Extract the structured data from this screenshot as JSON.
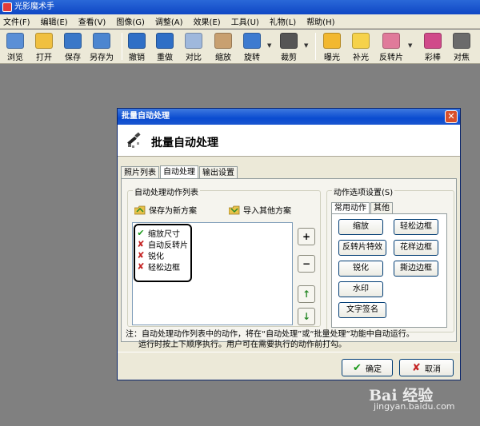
{
  "app": {
    "title": "光影魔术手"
  },
  "menu": [
    "文件(F)",
    "编辑(E)",
    "查看(V)",
    "图像(G)",
    "调整(A)",
    "效果(E)",
    "工具(U)",
    "礼物(L)",
    "帮助(H)"
  ],
  "toolbar": [
    {
      "label": "浏览",
      "icon": "eye-icon",
      "color": "#5a8fd6"
    },
    {
      "label": "打开",
      "icon": "folder-open-icon",
      "color": "#f0c040"
    },
    {
      "label": "保存",
      "icon": "floppy-disk-icon",
      "color": "#3a78c8"
    },
    {
      "label": "另存为",
      "icon": "save-as-icon",
      "color": "#4c86d0"
    },
    {
      "label": "撤销",
      "icon": "undo-arrow-icon",
      "color": "#2f6fc6"
    },
    {
      "label": "重做",
      "icon": "redo-arrow-icon",
      "color": "#2f6fc6"
    },
    {
      "label": "对比",
      "icon": "compare-icon",
      "color": "#9fb8dc"
    },
    {
      "label": "缩放",
      "icon": "resize-icon",
      "color": "#c8a070"
    },
    {
      "label": "旋转",
      "icon": "rotate-icon",
      "color": "#3d7bd0"
    },
    {
      "label": "裁剪",
      "icon": "crop-icon",
      "color": "#555555"
    },
    {
      "label": "曝光",
      "icon": "sun-exposure-icon",
      "color": "#f2b830"
    },
    {
      "label": "补光",
      "icon": "lightbulb-icon",
      "color": "#f6d24a"
    },
    {
      "label": "反转片",
      "icon": "slide-film-icon",
      "color": "#e07a9a"
    },
    {
      "label": "彩棒",
      "icon": "color-wand-icon",
      "color": "#d04a8a"
    },
    {
      "label": "对焦",
      "icon": "focus-icon",
      "color": "#6b6b6b"
    }
  ],
  "dialog": {
    "title": "批量自动处理",
    "close_glyph": "✕",
    "header_title": "批量自动处理",
    "tabs": [
      "照片列表",
      "自动处理",
      "输出设置"
    ],
    "active_tab": "自动处理",
    "action_list": {
      "label": "自动处理动作列表",
      "save_scheme": "保存为新方案",
      "import_scheme": "导入其他方案",
      "items": [
        {
          "label": "缩放尺寸",
          "enabled": true
        },
        {
          "label": "自动反转片",
          "enabled": false
        },
        {
          "label": "锐化",
          "enabled": false
        },
        {
          "label": "轻松边框",
          "enabled": false
        }
      ],
      "buttons": {
        "add": "+",
        "remove": "−",
        "up": "↑",
        "down": "↓"
      }
    },
    "options": {
      "label": "动作选项设置(S)",
      "tabs": [
        "常用动作",
        "其他"
      ],
      "active_tab": "常用动作",
      "buttons": [
        "缩放",
        "轻松边框",
        "反转片特效",
        "花样边框",
        "锐化",
        "撕边边框",
        "水印",
        "文字签名"
      ]
    },
    "note_line1": "注：自动处理动作列表中的动作，将在“自动处理”或“批量处理”功能中自动运行。",
    "note_line2": "运行时按上下顺序执行。用户可在需要执行的动作前打勾。",
    "ok": "确定",
    "ok_glyph": "✔",
    "cancel": "取消",
    "cancel_glyph": "✘"
  },
  "watermark": {
    "brand": "Bai 经验",
    "url": "jingyan.baidu.com"
  }
}
